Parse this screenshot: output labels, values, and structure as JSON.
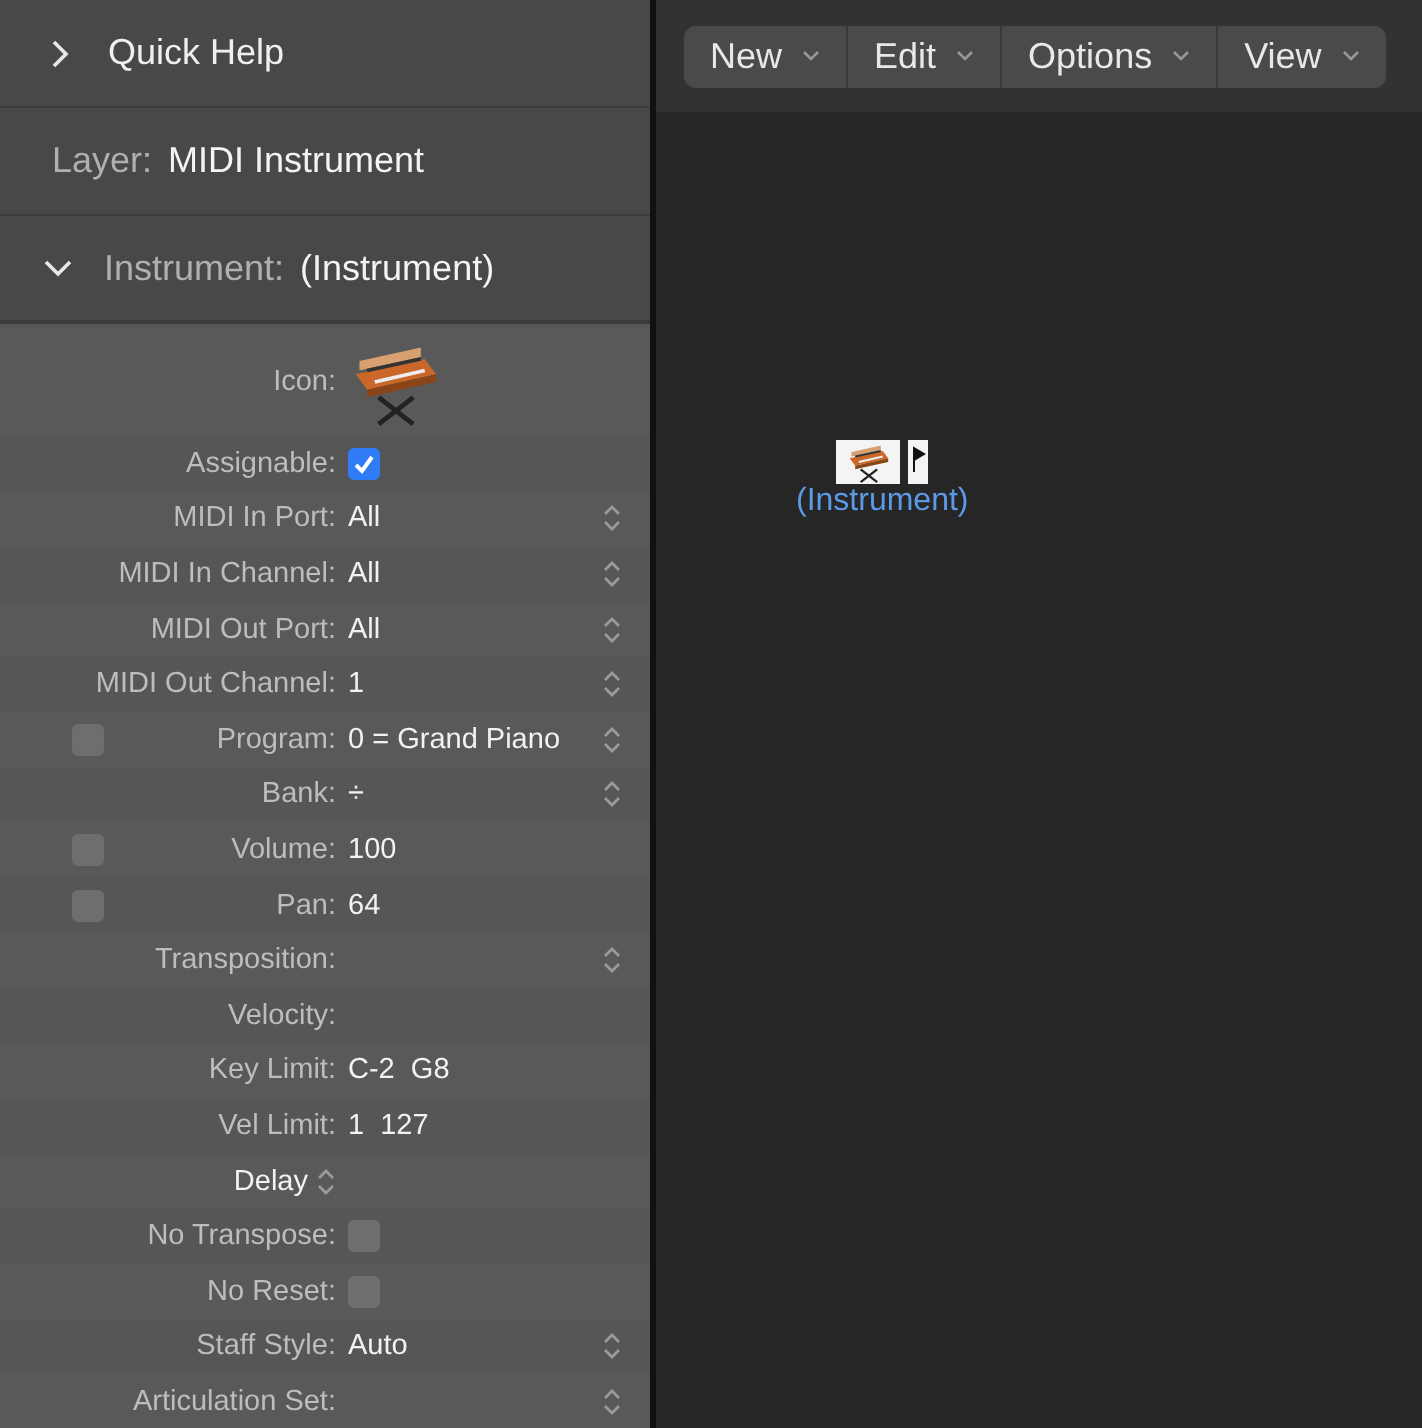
{
  "inspector": {
    "quick_help": {
      "title": "Quick Help",
      "expanded": false
    },
    "layer": {
      "label": "Layer:",
      "value": "MIDI Instrument"
    },
    "section": {
      "label": "Instrument:",
      "value": "(Instrument)",
      "expanded": true
    },
    "rows": [
      {
        "kind": "icon",
        "label": "Icon:"
      },
      {
        "kind": "check",
        "label": "Assignable:",
        "checked": true
      },
      {
        "kind": "value",
        "label": "MIDI In Port:",
        "value": "All",
        "stepper": true
      },
      {
        "kind": "value",
        "label": "MIDI In Channel:",
        "value": "All",
        "stepper": true
      },
      {
        "kind": "value",
        "label": "MIDI Out Port:",
        "value": "All",
        "stepper": true
      },
      {
        "kind": "value",
        "label": "MIDI Out Channel:",
        "value": "1",
        "stepper": true
      },
      {
        "kind": "value",
        "label": "Program:",
        "value": "0 = Grand Piano",
        "stepper": true,
        "enabled": false
      },
      {
        "kind": "value",
        "label": "Bank:",
        "value": "÷",
        "stepper": true
      },
      {
        "kind": "value",
        "label": "Volume:",
        "value": "100",
        "stepper": false,
        "enabled": false
      },
      {
        "kind": "value",
        "label": "Pan:",
        "value": "64",
        "stepper": false,
        "enabled": false
      },
      {
        "kind": "value",
        "label": "Transposition:",
        "stepper": true
      },
      {
        "kind": "value",
        "label": "Velocity:",
        "stepper": false
      },
      {
        "kind": "value",
        "label": "Key Limit:",
        "value": "C-2  G8",
        "stepper": false
      },
      {
        "kind": "value",
        "label": "Vel Limit:",
        "value": "1  127",
        "stepper": false
      },
      {
        "kind": "popup",
        "label": "Delay"
      },
      {
        "kind": "check",
        "label": "No Transpose:",
        "checked": false
      },
      {
        "kind": "check",
        "label": "No Reset:",
        "checked": false
      },
      {
        "kind": "value",
        "label": "Staff Style:",
        "value": "Auto",
        "stepper": true
      },
      {
        "kind": "value",
        "label": "Articulation Set:",
        "stepper": true
      }
    ]
  },
  "toolbar": {
    "menus": [
      "New",
      "Edit",
      "Options",
      "View"
    ]
  },
  "canvas": {
    "objects": [
      {
        "name": "(Instrument)"
      }
    ]
  }
}
